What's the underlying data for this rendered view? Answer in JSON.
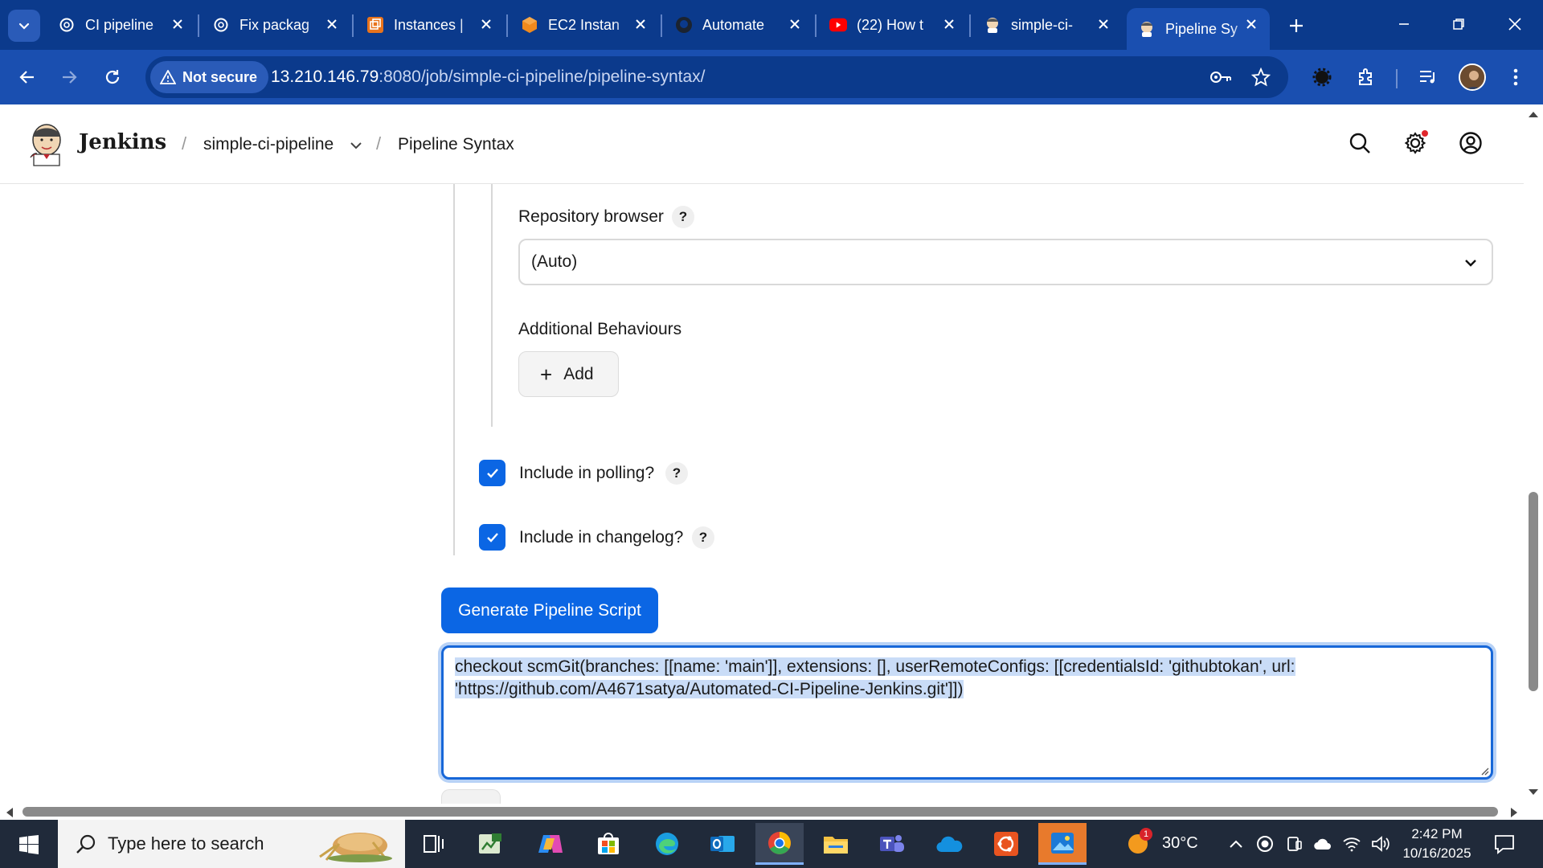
{
  "browser": {
    "tabs": [
      {
        "title": "CI pipeline",
        "icon": "chatgpt-icon"
      },
      {
        "title": "Fix packag",
        "icon": "chatgpt-icon"
      },
      {
        "title": "Instances |",
        "icon": "aws-icon"
      },
      {
        "title": "EC2 Instan",
        "icon": "aws-ec2-icon"
      },
      {
        "title": "Automate",
        "icon": "github-icon"
      },
      {
        "title": "(22) How t",
        "icon": "youtube-icon"
      },
      {
        "title": "simple-ci-",
        "icon": "jenkins-icon"
      },
      {
        "title": "Pipeline Sy",
        "icon": "jenkins-icon",
        "active": true
      }
    ],
    "security_label": "Not secure",
    "url_host": "13.210.146.79",
    "url_path": ":8080/job/simple-ci-pipeline/pipeline-syntax/",
    "accent": "#1a4fb0",
    "tabstrip_color": "#0b3a8c"
  },
  "jenkins": {
    "brand": "Jenkins",
    "breadcrumb": [
      "simple-ci-pipeline",
      "Pipeline Syntax"
    ]
  },
  "form": {
    "repo_browser_label": "Repository browser",
    "repo_browser_help": "?",
    "repo_browser_value": "(Auto)",
    "additional_behaviours_label": "Additional Behaviours",
    "add_button_label": "Add",
    "include_polling_label": "Include in polling?",
    "include_polling_checked": true,
    "include_changelog_label": "Include in changelog?",
    "include_changelog_checked": true,
    "help_glyph": "?",
    "generate_button_label": "Generate Pipeline Script",
    "generated_script_line1": "checkout scmGit(branches: [[name: 'main']], extensions: [], userRemoteConfigs: [[credentialsId: 'githubtokan', url: ",
    "generated_script_line2": "'https://github.com/A4671satya/Automated-CI-Pipeline-Jenkins.git']])",
    "primary_color": "#0b66e4"
  },
  "taskbar": {
    "search_placeholder": "Type here to search",
    "weather_temp": "30°C",
    "weather_badge": "1",
    "time": "2:42 PM",
    "date": "10/16/2025",
    "apps": [
      "task-view",
      "green-app",
      "copilot",
      "microsoft-store",
      "edge",
      "outlook",
      "chrome",
      "file-explorer",
      "teams",
      "onedrive",
      "ubuntu",
      "photos"
    ]
  }
}
